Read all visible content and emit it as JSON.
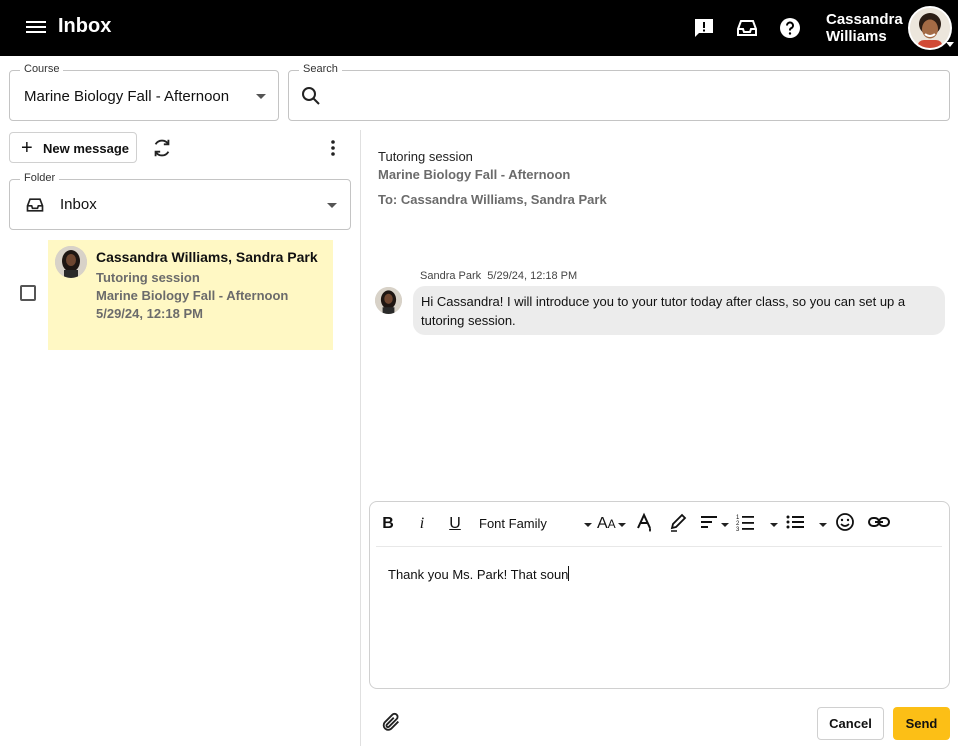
{
  "header": {
    "title": "Inbox",
    "user_first": "Cassandra",
    "user_last": "Williams",
    "icons": [
      "menu-icon",
      "feedback-icon",
      "inbox-tray-icon",
      "help-icon",
      "avatar"
    ]
  },
  "filters": {
    "course_label": "Course",
    "course_value": "Marine Biology Fall - Afternoon",
    "search_label": "Search",
    "search_value": ""
  },
  "list_panel": {
    "new_message_label": "New message",
    "folder_label": "Folder",
    "folder_value": "Inbox"
  },
  "conversations": [
    {
      "names": "Cassandra Williams, Sandra Park",
      "subject": "Tutoring session",
      "course": "Marine Biology Fall - Afternoon",
      "date": "5/29/24, 12:18 PM",
      "selected": false
    }
  ],
  "message_view": {
    "subject": "Tutoring session",
    "course": "Marine Biology Fall - Afternoon",
    "to_line": "To: Cassandra Williams, Sandra Park",
    "messages": [
      {
        "author": "Sandra Park",
        "date": "5/29/24, 12:18 PM",
        "text": "Hi Cassandra! I will introduce you to your tutor today after class, so you can set up a tutoring session."
      }
    ]
  },
  "composer": {
    "font_family_label": "Font Family",
    "draft_text": "Thank you Ms. Park! That soun",
    "cancel_label": "Cancel",
    "send_label": "Send",
    "accent_color": "#fcbf16"
  }
}
